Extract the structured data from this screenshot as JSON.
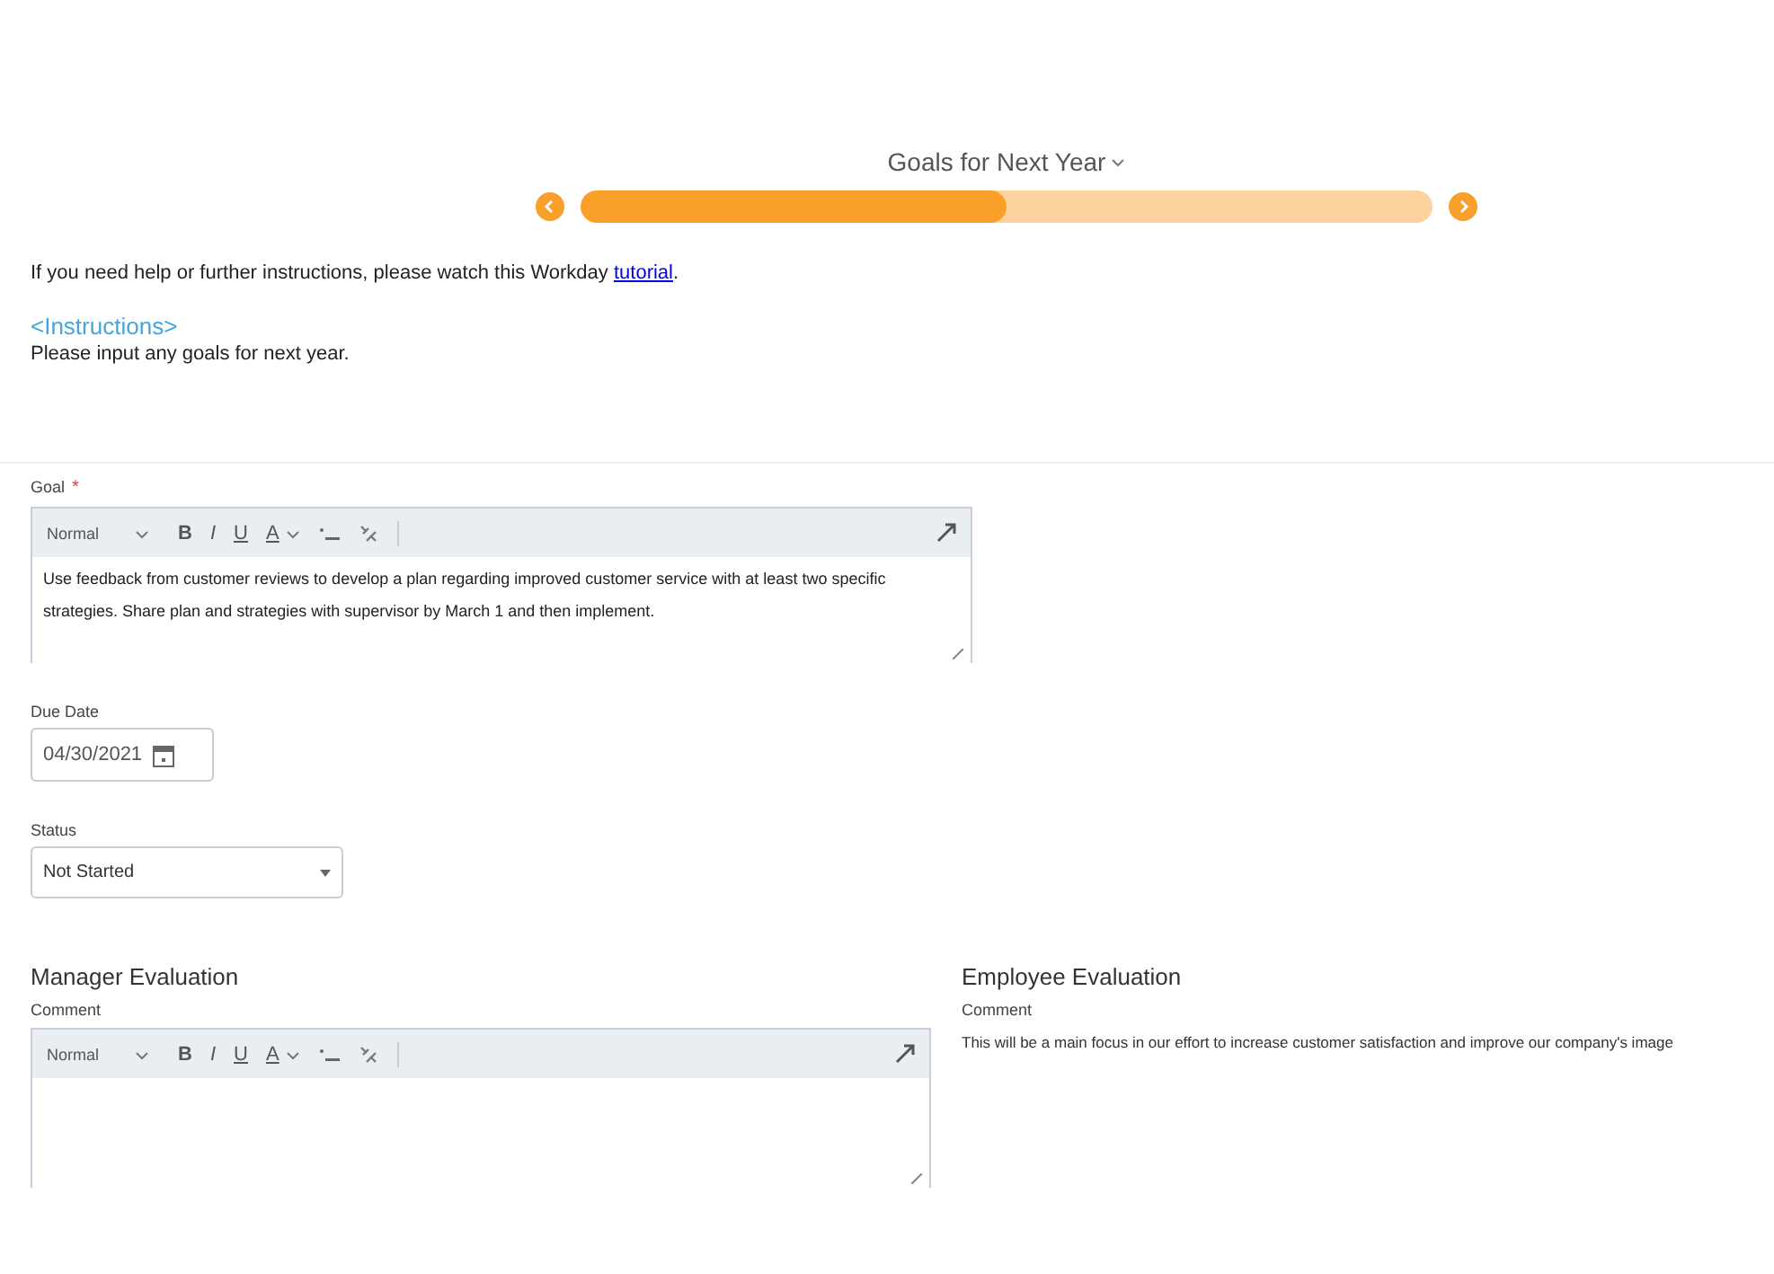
{
  "step": {
    "title": "Goals for Next Year",
    "level": 0.5
  },
  "help": {
    "text": "If you need help or further instructions, please watch this Workday ",
    "link": "tutorial",
    "after": "."
  },
  "instructions": {
    "heading": "<Instructions>",
    "text": "Please input any goals for next year."
  },
  "goal": {
    "label": "Goal",
    "required": "*",
    "toolbar": [
      {
        "kind": "format",
        "label": "Normal"
      },
      {
        "kind": "bold",
        "label": "B"
      },
      {
        "kind": "italic",
        "label": "I"
      },
      {
        "kind": "underline",
        "label": "U"
      },
      {
        "kind": "color",
        "label": "A"
      },
      {
        "kind": "list"
      },
      {
        "kind": "link"
      }
    ],
    "value": "Use feedback from customer reviews to develop a plan regarding improved customer service with at least two specific strategies. Share plan and strategies with supervisor by March 1 and then implement."
  },
  "due_date": {
    "label": "Due Date",
    "value": "04/30/2021"
  },
  "status": {
    "label": "Status",
    "value": "Not Started"
  },
  "manager_evaluation": {
    "heading": "Manager Evaluation",
    "label": "Comment",
    "toolbar": [
      {
        "kind": "format",
        "label": "Normal"
      },
      {
        "kind": "bold",
        "label": "B"
      },
      {
        "kind": "italic",
        "label": "I"
      },
      {
        "kind": "underline",
        "label": "U"
      },
      {
        "kind": "color",
        "label": "A"
      },
      {
        "kind": "list"
      },
      {
        "kind": "link"
      }
    ]
  },
  "employee_evaluation": {
    "heading": "Employee Evaluation",
    "label": "Comment",
    "text": "This will be a main focus in our effort to increase customer satisfaction and improve our company's image"
  }
}
